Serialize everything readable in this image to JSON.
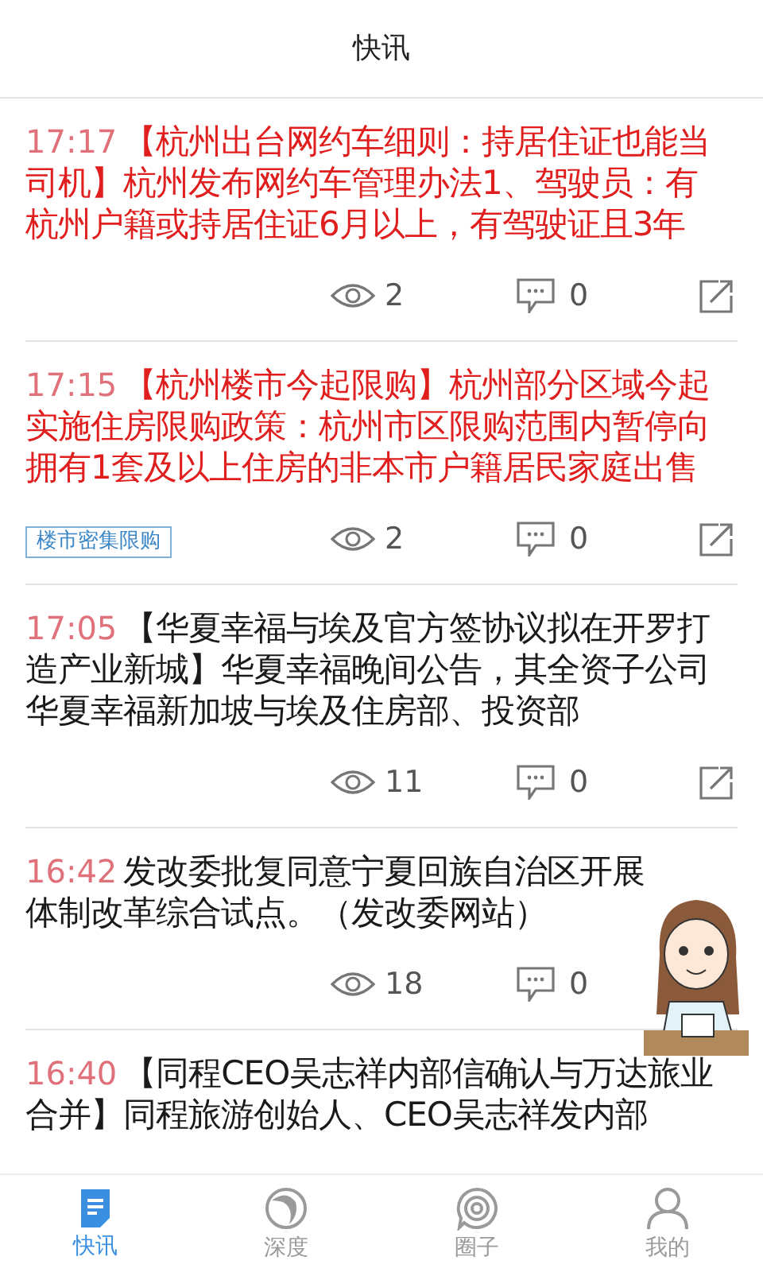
{
  "header": {
    "title": "快讯"
  },
  "news": [
    {
      "time": "17:17",
      "important": true,
      "lines": [
        "【杭州出台网约车细则：持居住证也能当",
        "司机】杭州发布网约车管理办法1、驾驶员：有",
        "杭州户籍或持居住证6月以上，有驾驶证且3年"
      ],
      "views": "2",
      "comments": "0",
      "share": true
    },
    {
      "time": "17:15",
      "important": true,
      "lines": [
        "【杭州楼市今起限购】杭州部分区域今起",
        "实施住房限购政策：杭州市区限购范围内暂停向",
        "拥有1套及以上住房的非本市户籍居民家庭出售"
      ],
      "views": "2",
      "comments": "0",
      "tag": "楼市密集限购",
      "share": true
    },
    {
      "time": "17:05",
      "important": false,
      "lines": [
        "【华夏幸福与埃及官方签协议拟在开罗打",
        "造产业新城】华夏幸福晚间公告，其全资子公司",
        "华夏幸福新加坡与埃及住房部、投资部"
      ],
      "views": "11",
      "comments": "0",
      "share": true
    },
    {
      "time": "16:42",
      "important": false,
      "lines": [
        "发改委批复同意宁夏回族自治区开展",
        "体制改革综合试点。（发改委网站）"
      ],
      "views": "18",
      "comments": "0",
      "share": false
    },
    {
      "time": "16:40",
      "important": false,
      "lines": [
        "【同程CEO吴志祥内部信确认与万达旅业",
        "合并】同程旅游创始人、CEO吴志祥发内部"
      ]
    }
  ],
  "tabs": [
    {
      "label": "快讯",
      "selected": true
    },
    {
      "label": "深度",
      "selected": false
    },
    {
      "label": "圈子",
      "selected": false
    },
    {
      "label": "我的",
      "selected": false
    }
  ]
}
